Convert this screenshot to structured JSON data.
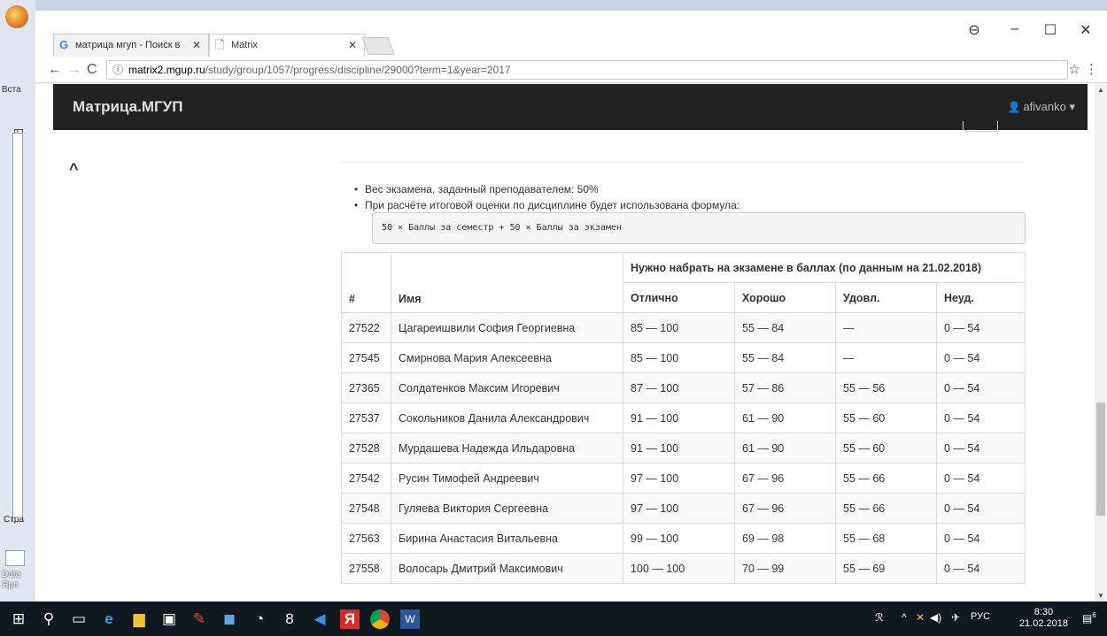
{
  "word": {
    "insert_label": "Вста",
    "page_label": "Стра",
    "desktop_label": "Data Ярл"
  },
  "browser": {
    "tabs": [
      {
        "label": "матрица мгуп - Поиск в",
        "favicon": "google-icon",
        "active": false
      },
      {
        "label": "Matrix",
        "favicon": "page-icon",
        "active": true
      }
    ],
    "url": {
      "host": "matrix2.mgup.ru",
      "path": "/study/group/1057/progress/discipline/29000?term=1&year=2017"
    }
  },
  "navbar": {
    "brand": "Матрица.МГУП",
    "user": "afivanko"
  },
  "info": {
    "exam_weight": "Вес экзамена, заданный преподавателем: 50%",
    "formula_note": "При расчёте итоговой оценки по дисциплине будет использована формула:",
    "formula": "50 × Баллы за семестр + 50 × Баллы за экзамен"
  },
  "table": {
    "group_header": "Нужно набрать на экзамене в баллах (по данным на 21.02.2018)",
    "col_num": "#",
    "col_name": "Имя",
    "grade_headers": [
      "Отлично",
      "Хорошо",
      "Удовл.",
      "Неуд."
    ],
    "rows": [
      {
        "id": "27522",
        "name": "Цагареишвили София Георгиевна",
        "excellent": "85 — 100",
        "good": "55 — 84",
        "satisfactory": "—",
        "fail": "0 — 54"
      },
      {
        "id": "27545",
        "name": "Смирнова Мария Алексеевна",
        "excellent": "85 — 100",
        "good": "55 — 84",
        "satisfactory": "—",
        "fail": "0 — 54"
      },
      {
        "id": "27365",
        "name": "Солдатенков Максим Игоревич",
        "excellent": "87 — 100",
        "good": "57 — 86",
        "satisfactory": "55 — 56",
        "fail": "0 — 54"
      },
      {
        "id": "27537",
        "name": "Сокольников Данила Александрович",
        "excellent": "91 — 100",
        "good": "61 — 90",
        "satisfactory": "55 — 60",
        "fail": "0 — 54"
      },
      {
        "id": "27528",
        "name": "Мурдашева Надежда Ильдаровна",
        "excellent": "91 — 100",
        "good": "61 — 90",
        "satisfactory": "55 — 60",
        "fail": "0 — 54"
      },
      {
        "id": "27542",
        "name": "Русин Тимофей Андреевич",
        "excellent": "97 — 100",
        "good": "67 — 96",
        "satisfactory": "55 — 66",
        "fail": "0 — 54"
      },
      {
        "id": "27548",
        "name": "Гуляева Виктория Сергеевна",
        "excellent": "97 — 100",
        "good": "67 — 96",
        "satisfactory": "55 — 66",
        "fail": "0 — 54"
      },
      {
        "id": "27563",
        "name": "Бирина Анастасия Витальевна",
        "excellent": "99 — 100",
        "good": "69 — 98",
        "satisfactory": "55 — 68",
        "fail": "0 — 54"
      },
      {
        "id": "27558",
        "name": "Волосарь Дмитрий Максимович",
        "excellent": "100 — 100",
        "good": "70 — 99",
        "satisfactory": "55 — 69",
        "fail": "0 — 54"
      }
    ]
  },
  "taskbar": {
    "lang": "РУС",
    "time": "8:30",
    "date": "21.02.2018",
    "notifications": "6"
  },
  "colors": {
    "navbar": "#222222",
    "taskbar": "#101820",
    "row_stripe": "#f9f9f9"
  }
}
